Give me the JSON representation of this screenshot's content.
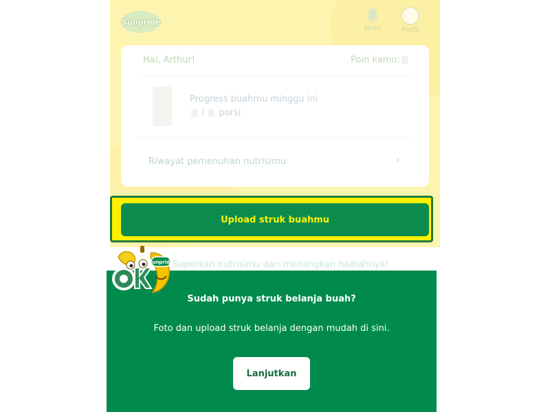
{
  "header": {
    "logo_text": "Sunpride",
    "notif_label": "Notif",
    "profile_label": "Profil",
    "notif_icon": "bell-icon",
    "profile_icon": "avatar-icon"
  },
  "summary_card": {
    "greeting": "Hai, Arthur!",
    "points_label": "Poin kamu:",
    "progress_title": "Progress buahmu minggu ini",
    "progress_separator": "/",
    "progress_unit": "porsi",
    "history_link": "Riwayat pemenuhan nutrisimu",
    "history_chevron": "›"
  },
  "upload_button": {
    "label": "Upload struk buahmu"
  },
  "tagline": "Superkan nutrisimu dan menangkan hadiahnya!",
  "mascot": {
    "badge_text": "Sunpride",
    "ok_text": "OK",
    "icon": "banana-mascot-icon"
  },
  "onboarding": {
    "title": "Sudah punya struk belanja buah?",
    "description": "Foto dan upload struk belanja dengan mudah di sini.",
    "button_label": "Lanjutkan"
  },
  "colors": {
    "page_background": "#fdf4b0",
    "primary_green": "#008a4c",
    "highlight_yellow": "#fff000",
    "button_text_yellow": "#fff20a"
  }
}
